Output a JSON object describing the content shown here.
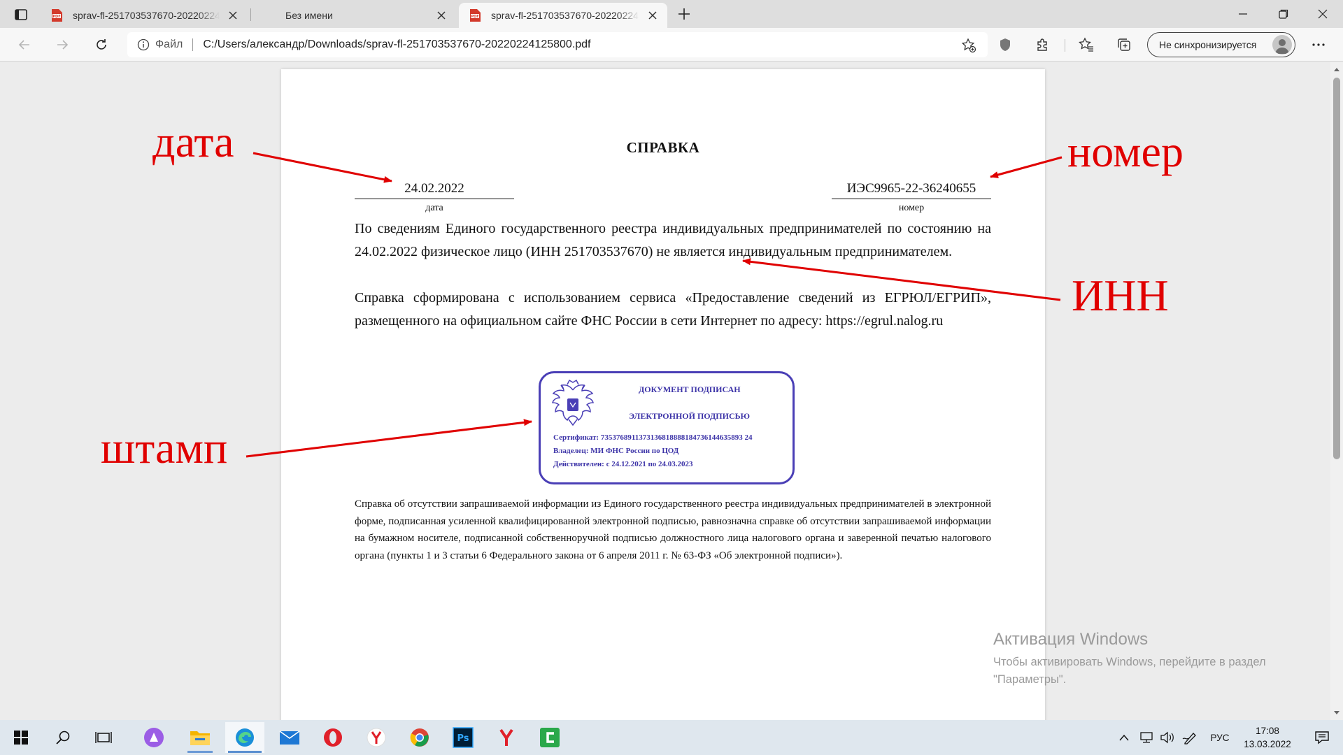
{
  "browser": {
    "tabs": [
      {
        "title": "sprav-fl-251703537670-20220224125800.pdf",
        "active": false
      },
      {
        "title": "Без имени",
        "active": false
      },
      {
        "title": "sprav-fl-251703537670-20220224125800.pdf",
        "active": true
      }
    ],
    "address": {
      "scheme_label": "Файл",
      "url": "C:/Users/александр/Downloads/sprav-fl-251703537670-20220224125800.pdf"
    },
    "sync_label": "Не синхронизируется"
  },
  "document": {
    "title": "СПРАВКА",
    "date_value": "24.02.2022",
    "date_caption": "дата",
    "number_value": "ИЭС9965-22-36240655",
    "number_caption": "номер",
    "paragraph_1": "По сведениям Единого государственного реестра индивидуальных предпринимателей по состоянию на 24.02.2022 физическое лицо (ИНН 251703537670) не является индивидуальным предпринимателем.",
    "paragraph_2": "Справка сформирована с использованием сервиса «Предоставление сведений из ЕГРЮЛ/ЕГРИП», размещенного на официальном сайте ФНС России в сети Интернет по адресу: https://egrul.nalog.ru",
    "stamp": {
      "line_1": "ДОКУМЕНТ ПОДПИСАН",
      "line_2": "ЭЛЕКТРОННОЙ ПОДПИСЬЮ",
      "certificate": "Сертификат: 7353768911373136818888184736144635893 24",
      "owner": "Владелец: МИ ФНС России по ЦОД",
      "validity": "Действителен: с 24.12.2021 по 24.03.2023"
    },
    "footnote": "Справка об отсутствии запрашиваемой информации из Единого государственного реестра индивидуальных предпринимателей в электронной форме, подписанная усиленной квалифицированной электронной подписью, равнозначна справке об отсутствии запрашиваемой информации на бумажном носителе, подписанной собственноручной подписью должностного лица налогового органа и заверенной печатью налогового органа (пункты 1 и 3 статьи 6 Федерального закона от 6 апреля 2011 г. № 63-ФЗ «Об электронной подписи»)."
  },
  "annotations": {
    "date": "дата",
    "number": "номер",
    "inn": "ИНН",
    "stamp": "штамп",
    "color": "#e00000"
  },
  "watermark": {
    "title": "Активация Windows",
    "text_line_1": "Чтобы активировать Windows, перейдите в раздел",
    "text_line_2": "\"Параметры\"."
  },
  "taskbar": {
    "language": "РУС",
    "time": "17:08",
    "date": "13.03.2022"
  },
  "icons": [
    "windows-logo-icon",
    "search-icon",
    "task-view-icon",
    "alice-icon",
    "file-explorer-icon",
    "edge-icon",
    "mail-icon",
    "opera-icon",
    "yandex-browser-icon",
    "chrome-icon",
    "photoshop-icon",
    "yandex-icon",
    "camtasia-icon"
  ]
}
